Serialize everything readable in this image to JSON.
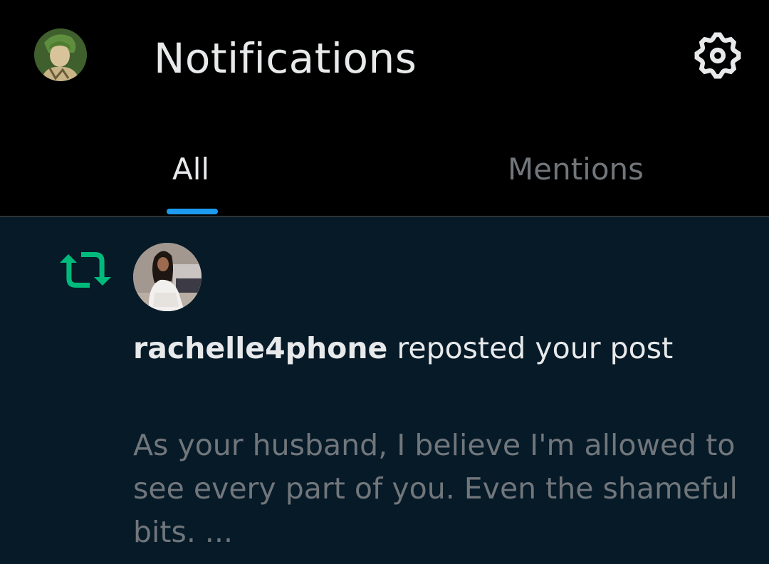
{
  "header": {
    "title": "Notifications",
    "avatar_icon": "profile-avatar",
    "settings_icon": "gear-icon"
  },
  "tabs": [
    {
      "label": "All",
      "selected": true
    },
    {
      "label": "Mentions",
      "selected": false
    }
  ],
  "notifications": [
    {
      "type": "repost",
      "icon": "repost-icon",
      "username": "rachelle4phone",
      "action": "reposted your post",
      "post_preview": "As your husband, I believe I'm allowed to see every part of you. Even the shameful bits. ..."
    }
  ],
  "colors": {
    "background": "#000000",
    "card_background": "#061a28",
    "primary_text": "#e7e9ea",
    "secondary_text": "#71767b",
    "accent": "#1d9bf0",
    "repost_green": "#00ba7c"
  }
}
